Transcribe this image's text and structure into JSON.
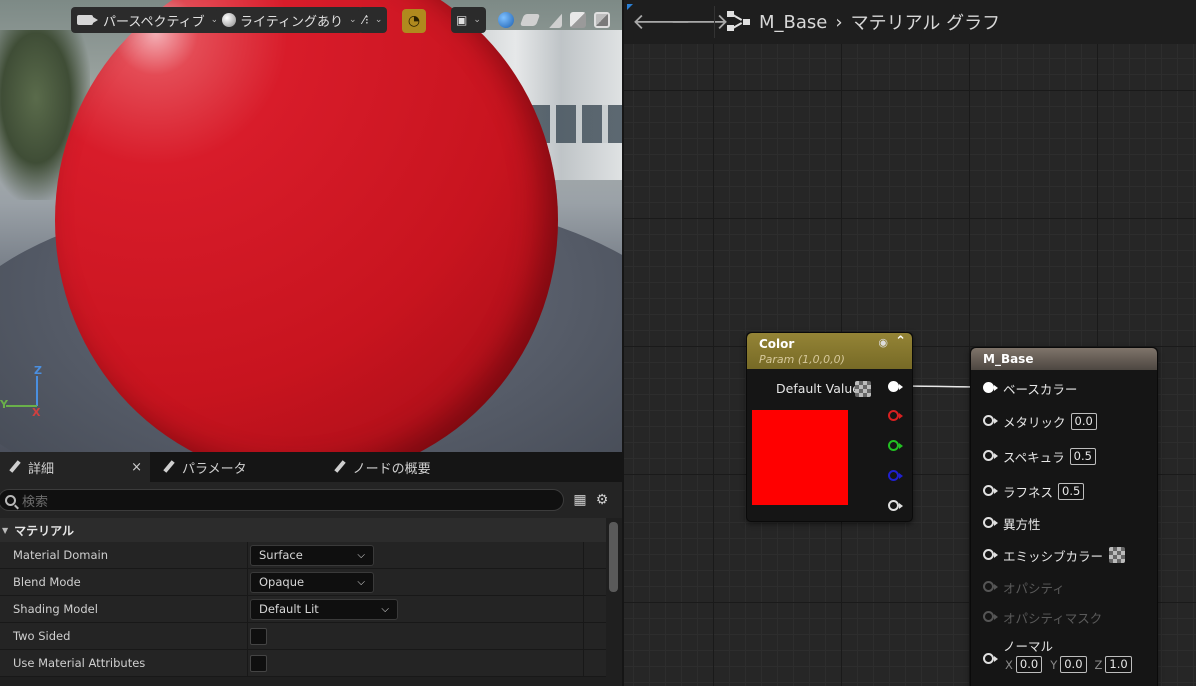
{
  "viewport": {
    "toolbar": {
      "perspective_label": "パースペクティブ",
      "lighting_label": "ライティングあり"
    },
    "gizmo": {
      "x": "X",
      "y": "Y",
      "z": "Z"
    }
  },
  "details": {
    "tabs": [
      {
        "label": "詳細"
      },
      {
        "label": "パラメータ"
      },
      {
        "label": "ノードの概要"
      }
    ],
    "search": {
      "placeholder": "検索"
    },
    "section_title": "マテリアル",
    "properties": [
      {
        "name": "Material Domain",
        "value": "Surface"
      },
      {
        "name": "Blend Mode",
        "value": "Opaque"
      },
      {
        "name": "Shading Model",
        "value": "Default Lit"
      },
      {
        "name": "Two Sided",
        "value": false
      },
      {
        "name": "Use Material Attributes",
        "value": false
      }
    ]
  },
  "graph": {
    "breadcrumb": {
      "asset": "M_Base",
      "view": "マテリアル グラフ"
    },
    "color_node": {
      "title": "Color",
      "subtitle": "Param (1,0,0,0)",
      "default_value_label": "Default Value",
      "swatch_color": "#ff0000",
      "header_color": "#8a7a2e"
    },
    "base_node": {
      "title": "M_Base",
      "inputs": [
        {
          "label": "ベースカラー",
          "value": ""
        },
        {
          "label": "メタリック",
          "value": "0.0"
        },
        {
          "label": "スペキュラ",
          "value": "0.5"
        },
        {
          "label": "ラフネス",
          "value": "0.5"
        },
        {
          "label": "異方性",
          "value": ""
        },
        {
          "label": "エミッシブカラー",
          "value": ""
        },
        {
          "label": "オパシティ",
          "value": ""
        },
        {
          "label": "オパシティマスク",
          "value": ""
        },
        {
          "label": "ノーマル",
          "value": ""
        }
      ],
      "normal": {
        "x_label": "X",
        "x": "0.0",
        "y_label": "Y",
        "y": "0.0",
        "z_label": "Z",
        "z": "1.0"
      }
    }
  }
}
